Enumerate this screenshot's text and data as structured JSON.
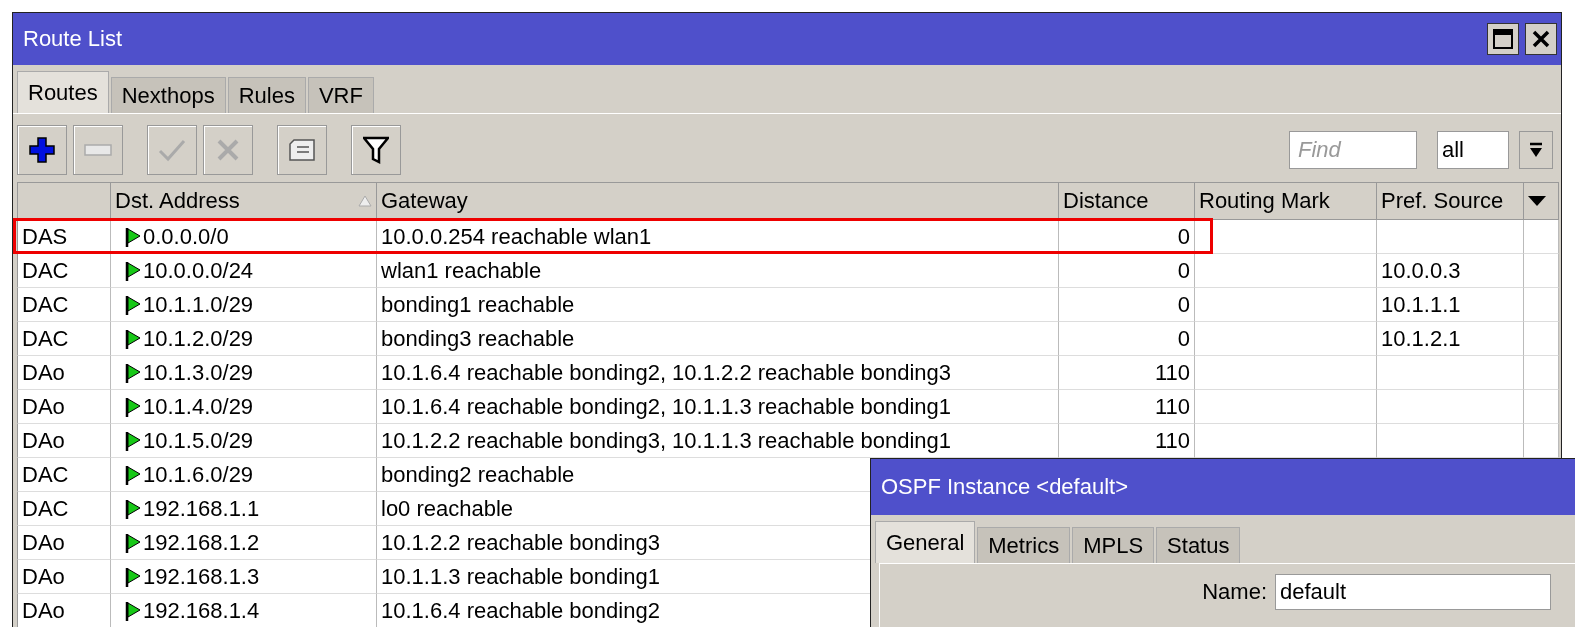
{
  "window": {
    "title": "Route List"
  },
  "tabs": [
    {
      "label": "Routes",
      "selected": true
    },
    {
      "label": "Nexthops",
      "selected": false
    },
    {
      "label": "Rules",
      "selected": false
    },
    {
      "label": "VRF",
      "selected": false
    }
  ],
  "toolbar": [
    {
      "kind": "add",
      "disabled": false
    },
    {
      "kind": "remove",
      "disabled": true
    },
    {
      "kind": "enable",
      "disabled": true
    },
    {
      "kind": "disable",
      "disabled": true
    },
    {
      "kind": "comment",
      "disabled": false
    },
    {
      "kind": "filter",
      "disabled": false
    }
  ],
  "find": {
    "placeholder": "Find"
  },
  "filter_select": {
    "value": "all"
  },
  "table": {
    "columns": [
      "",
      "Dst. Address",
      "Gateway",
      "Distance",
      "Routing Mark",
      "Pref. Source"
    ],
    "rows": [
      {
        "flags": "DAS",
        "dst": "0.0.0.0/0",
        "gateway": "10.0.0.254 reachable wlan1",
        "distance": "0",
        "pref_source": "",
        "highlighted": true
      },
      {
        "flags": "DAC",
        "dst": "10.0.0.0/24",
        "gateway": "wlan1 reachable",
        "distance": "0",
        "pref_source": "10.0.0.3",
        "highlighted": false
      },
      {
        "flags": "DAC",
        "dst": "10.1.1.0/29",
        "gateway": "bonding1 reachable",
        "distance": "0",
        "pref_source": "10.1.1.1",
        "highlighted": false
      },
      {
        "flags": "DAC",
        "dst": "10.1.2.0/29",
        "gateway": "bonding3 reachable",
        "distance": "0",
        "pref_source": "10.1.2.1",
        "highlighted": false
      },
      {
        "flags": "DAo",
        "dst": "10.1.3.0/29",
        "gateway": "10.1.6.4 reachable bonding2, 10.1.2.2 reachable bonding3",
        "distance": "110",
        "pref_source": "",
        "highlighted": false
      },
      {
        "flags": "DAo",
        "dst": "10.1.4.0/29",
        "gateway": "10.1.6.4 reachable bonding2, 10.1.1.3 reachable bonding1",
        "distance": "110",
        "pref_source": "",
        "highlighted": false
      },
      {
        "flags": "DAo",
        "dst": "10.1.5.0/29",
        "gateway": "10.1.2.2 reachable bonding3, 10.1.1.3 reachable bonding1",
        "distance": "110",
        "pref_source": "",
        "highlighted": false
      },
      {
        "flags": "DAC",
        "dst": "10.1.6.0/29",
        "gateway": "bonding2 reachable",
        "highlighted": false
      },
      {
        "flags": "DAC",
        "dst": "192.168.1.1",
        "gateway": "lo0 reachable",
        "highlighted": false
      },
      {
        "flags": "DAo",
        "dst": "192.168.1.2",
        "gateway": "10.1.2.2 reachable bonding3",
        "highlighted": false
      },
      {
        "flags": "DAo",
        "dst": "192.168.1.3",
        "gateway": "10.1.1.3 reachable bonding1",
        "highlighted": false
      },
      {
        "flags": "DAo",
        "dst": "192.168.1.4",
        "gateway": "10.1.6.4 reachable bonding2",
        "highlighted": false
      }
    ]
  },
  "dialog": {
    "title": "OSPF Instance <default>",
    "tabs": [
      {
        "label": "General",
        "selected": true
      },
      {
        "label": "Metrics",
        "selected": false
      },
      {
        "label": "MPLS",
        "selected": false
      },
      {
        "label": "Status",
        "selected": false
      }
    ],
    "fields": [
      {
        "label": "Name:",
        "value": "default"
      }
    ]
  }
}
